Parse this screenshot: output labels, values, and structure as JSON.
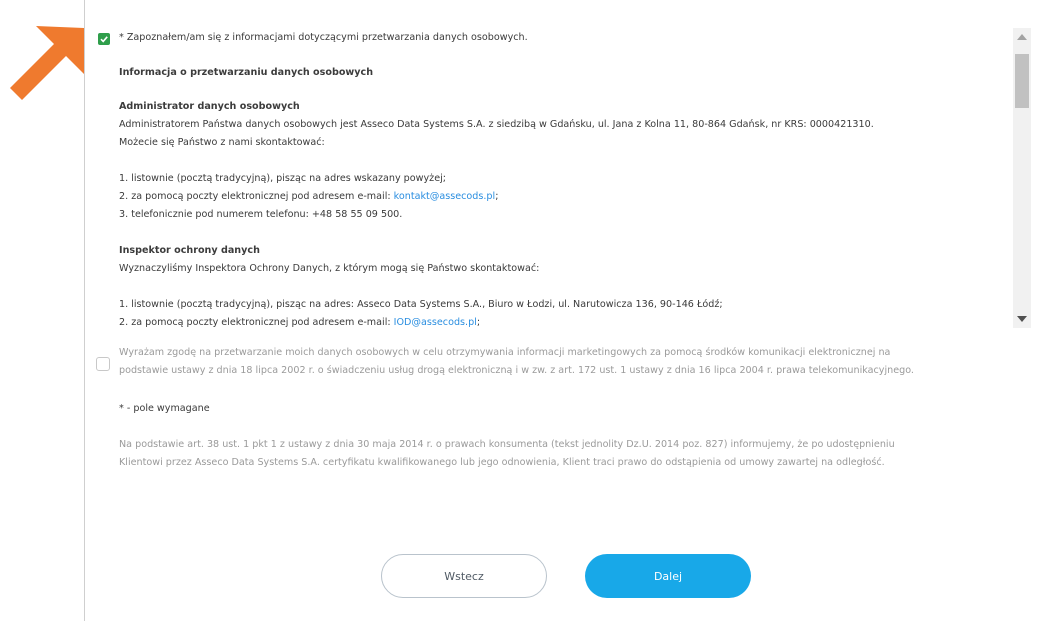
{
  "accent_color": "#18a8e8",
  "arrow_color": "#ef7a2e",
  "consent_required": {
    "checked": true,
    "label": "* Zapoznałem/am się z informacjami dotyczącymi przetwarzania danych osobowych.",
    "info_heading": "Informacja o przetwarzaniu danych osobowych",
    "admin": {
      "heading": "Administrator danych osobowych",
      "line1": "Administratorem Państwa danych osobowych jest Asseco Data Systems S.A. z siedzibą w Gdańsku, ul. Jana z Kolna 11, 80-864 Gdańsk, nr KRS: 0000421310.",
      "line2": "Możecie się Państwo z nami skontaktować:",
      "contact1": "1. listownie (pocztą tradycyjną), pisząc na adres wskazany powyżej;",
      "contact2_prefix": "2. za pomocą poczty elektronicznej pod adresem e-mail: ",
      "contact2_email": "kontakt@assecods.pl",
      "contact2_suffix": ";",
      "contact3": "3. telefonicznie pod numerem telefonu: +48 58 55 09 500."
    },
    "iod": {
      "heading": "Inspektor ochrony danych",
      "line1": "Wyznaczyliśmy Inspektora Ochrony Danych, z którym mogą się Państwo skontaktować:",
      "contact1": "1. listownie (pocztą tradycyjną), pisząc na adres: Asseco Data Systems S.A., Biuro w Łodzi, ul. Narutowicza 136, 90-146 Łódź;",
      "contact2_prefix": "2. za pomocą poczty elektronicznej pod adresem e-mail: ",
      "contact2_email": "IOD@assecods.pl",
      "contact2_suffix": ";"
    }
  },
  "consent_marketing": {
    "checked": false,
    "line1": "Wyrażam zgodę na przetwarzanie moich danych osobowych w celu otrzymywania informacji marketingowych za pomocą środków komunikacji elektronicznej na",
    "line2": "podstawie ustawy z dnia 18 lipca 2002 r. o świadczeniu usług drogą elektroniczną i w zw. z art. 172 ust. 1 ustawy z dnia 16 lipca 2004 r. prawa telekomunikacyjnego."
  },
  "required_note": "* - pole wymagane",
  "legal_note": {
    "line1": "Na podstawie art. 38 ust. 1 pkt 1 z ustawy z dnia 30 maja 2014 r. o prawach konsumenta (tekst jednolity Dz.U. 2014 poz. 827) informujemy, że po udostępnieniu",
    "line2": "Klientowi przez Asseco Data Systems S.A. certyfikatu kwalifikowanego lub jego odnowienia, Klient traci prawo do odstąpienia od umowy zawartej na odległość."
  },
  "buttons": {
    "back": "Wstecz",
    "next": "Dalej"
  }
}
